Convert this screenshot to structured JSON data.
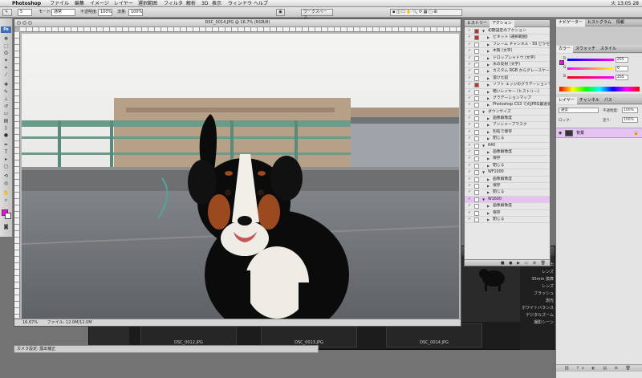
{
  "menubar": {
    "app": "Photoshop",
    "items": [
      "ファイル",
      "編集",
      "イメージ",
      "レイヤー",
      "選択範囲",
      "フィルタ",
      "解析",
      "3D",
      "表示",
      "ウィンドウ",
      "ヘルプ"
    ],
    "clock": "火 13:05",
    "battery": "28"
  },
  "options": {
    "brush_size": "5",
    "mode_label": "モード:",
    "mode_value": "通常",
    "opacity_label": "不透明度:",
    "opacity_value": "100%",
    "flow_label": "流量:",
    "flow_value": "100%",
    "workspace": "ワークスペース"
  },
  "document": {
    "title": "DSC_0014.JPG @ 16.7% (RGB/8)",
    "zoom": "16.67%",
    "docinfo": "ファイル: 12.0M/12.0M"
  },
  "status_bottom": "カメラ設定: 露出補正",
  "browser": {
    "captions": [
      "DSC_0012.JPG",
      "DSC_0013.JPG",
      "DSC_0014.JPG"
    ],
    "info_lines": [
      "露出",
      "レンズ",
      "35mm 換算",
      "レンズ",
      "フラッシュ",
      "測光",
      "ホワイトバランス",
      "デジタルズーム",
      "撮影シーン"
    ]
  },
  "actions_panel": {
    "tabs": [
      "ヒストリー",
      "アクション"
    ],
    "rows": [
      {
        "chk": "✓",
        "dlg": "red",
        "tri": "▼",
        "indent": 0,
        "text": "初期設定のアクション"
      },
      {
        "chk": "✓",
        "dlg": "red",
        "tri": "▶",
        "indent": 1,
        "text": "ビネット (選択範囲)"
      },
      {
        "chk": "✓",
        "dlg": "",
        "tri": "▶",
        "indent": 1,
        "text": "フレーム チャンネル - 50 ピクセル"
      },
      {
        "chk": "✓",
        "dlg": "",
        "tri": "▶",
        "indent": 1,
        "text": "木製 (文字)"
      },
      {
        "chk": "✓",
        "dlg": "",
        "tri": "▶",
        "indent": 1,
        "text": "ドロップシャドウ (文字)"
      },
      {
        "chk": "✓",
        "dlg": "",
        "tri": "▶",
        "indent": 1,
        "text": "水の反射 (文字)"
      },
      {
        "chk": "✓",
        "dlg": "",
        "tri": "▶",
        "indent": 1,
        "text": "カスタム RGB からグレースケール"
      },
      {
        "chk": "✓",
        "dlg": "",
        "tri": "▶",
        "indent": 1,
        "text": "溶けた鉛"
      },
      {
        "chk": "✓",
        "dlg": "red",
        "tri": "▶",
        "indent": 1,
        "text": "ソフト エッジのグラデーションマップ"
      },
      {
        "chk": "✓",
        "dlg": "",
        "tri": "▶",
        "indent": 1,
        "text": "暗いレイヤー (ヒストリー)"
      },
      {
        "chk": "✓",
        "dlg": "",
        "tri": "▶",
        "indent": 1,
        "text": "グラデーションマップ"
      },
      {
        "chk": "✓",
        "dlg": "",
        "tri": "▶",
        "indent": 1,
        "text": "Photoshop CS3 でのJPEG最適化"
      },
      {
        "chk": "✓",
        "dlg": "",
        "tri": "▼",
        "indent": 0,
        "text": "ダウンサイズ"
      },
      {
        "chk": "✓",
        "dlg": "",
        "tri": "▶",
        "indent": 1,
        "text": "画像解像度"
      },
      {
        "chk": "✓",
        "dlg": "",
        "tri": "▶",
        "indent": 1,
        "text": "アンシャープマスク"
      },
      {
        "chk": "✓",
        "dlg": "",
        "tri": "▶",
        "indent": 1,
        "text": "別名で保存"
      },
      {
        "chk": "✓",
        "dlg": "",
        "tri": "▶",
        "indent": 1,
        "text": "閉じる"
      },
      {
        "chk": "✓",
        "dlg": "",
        "tri": "▼",
        "indent": 0,
        "text": "640"
      },
      {
        "chk": "✓",
        "dlg": "",
        "tri": "▶",
        "indent": 1,
        "text": "画像解像度"
      },
      {
        "chk": "✓",
        "dlg": "",
        "tri": "▶",
        "indent": 1,
        "text": "保存"
      },
      {
        "chk": "✓",
        "dlg": "",
        "tri": "▶",
        "indent": 1,
        "text": "閉じる"
      },
      {
        "chk": "✓",
        "dlg": "",
        "tri": "▼",
        "indent": 0,
        "text": "WF1000"
      },
      {
        "chk": "✓",
        "dlg": "",
        "tri": "▶",
        "indent": 1,
        "text": "画像解像度"
      },
      {
        "chk": "✓",
        "dlg": "",
        "tri": "▶",
        "indent": 1,
        "text": "保存"
      },
      {
        "chk": "✓",
        "dlg": "",
        "tri": "▶",
        "indent": 1,
        "text": "閉じる"
      },
      {
        "chk": "✓",
        "dlg": "",
        "tri": "▼",
        "indent": 0,
        "text": "W1600",
        "selected": true
      },
      {
        "chk": "✓",
        "dlg": "",
        "tri": "▶",
        "indent": 1,
        "text": "画像解像度"
      },
      {
        "chk": "✓",
        "dlg": "",
        "tri": "▶",
        "indent": 1,
        "text": "保存"
      },
      {
        "chk": "✓",
        "dlg": "",
        "tri": "▶",
        "indent": 1,
        "text": "閉じる"
      }
    ],
    "footer_icons": "■ ● ▶ ▭ ⊕ 🗑"
  },
  "dock": {
    "top_tabs": [
      "カラー",
      "スウォッチ",
      "スタイル"
    ],
    "header_tabs": [
      "ナビゲーター",
      "ヒストグラム",
      "情報"
    ],
    "color": {
      "r_label": "R",
      "r_value": "255",
      "g_label": "G",
      "g_value": "0",
      "b_label": "B",
      "b_value": "255"
    },
    "layers_tabs": [
      "レイヤー",
      "チャンネル",
      "パス"
    ],
    "blend_mode": "通常",
    "opacity_label": "不透明度:",
    "opacity_value": "100%",
    "lock_label": "ロック:",
    "fill_label": "塗り:",
    "fill_value": "100%",
    "layer_name": "背景",
    "footer_icons": "⛓ fx ◐ ▤ ⊕ 🗑"
  },
  "colors": {
    "foreground": "#ff00ff",
    "selection": "#e6c3f0"
  }
}
